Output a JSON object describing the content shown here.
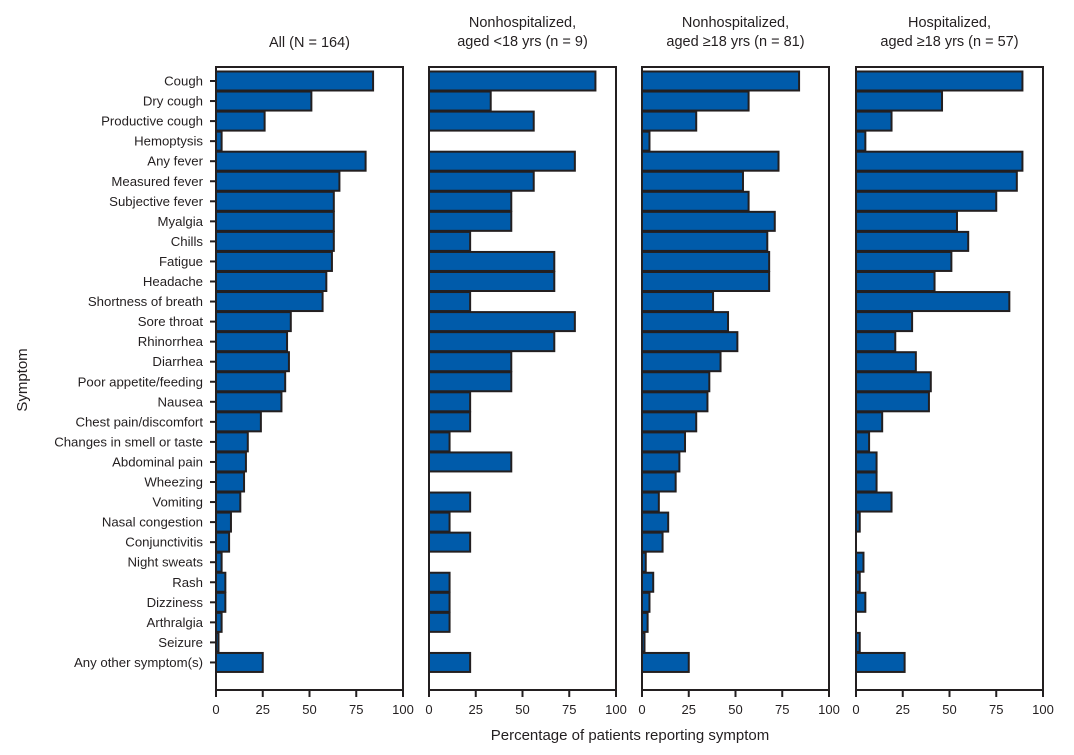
{
  "chart_data": {
    "type": "bar",
    "orientation": "horizontal",
    "xlabel": "Percentage of patients reporting symptom",
    "ylabel": "Symptom",
    "xlim": [
      0,
      100
    ],
    "xticks": [
      0,
      25,
      50,
      75,
      100
    ],
    "grid": false,
    "bar_color": "#005baa",
    "categories": [
      "Cough",
      "Dry cough",
      "Productive cough",
      "Hemoptysis",
      "Any fever",
      "Measured fever",
      "Subjective fever",
      "Myalgia",
      "Chills",
      "Fatigue",
      "Headache",
      "Shortness of breath",
      "Sore throat",
      "Rhinorrhea",
      "Diarrhea",
      "Poor appetite/feeding",
      "Nausea",
      "Chest pain/discomfort",
      "Changes in smell or taste",
      "Abdominal pain",
      "Wheezing",
      "Vomiting",
      "Nasal congestion",
      "Conjunctivitis",
      "Night sweats",
      "Rash",
      "Dizziness",
      "Arthralgia",
      "Seizure",
      "Any other symptom(s)"
    ],
    "panels": [
      {
        "title_lines": [
          "All (N = 164)"
        ],
        "values": [
          84,
          51,
          26,
          3,
          80,
          66,
          63,
          63,
          63,
          62,
          59,
          57,
          40,
          38,
          39,
          37,
          35,
          24,
          17,
          16,
          15,
          13,
          8,
          7,
          3,
          5,
          5,
          3,
          1,
          25
        ]
      },
      {
        "title_lines": [
          "Nonhospitalized,",
          "aged <18 yrs (n = 9)"
        ],
        "values": [
          89,
          33,
          56,
          0,
          78,
          56,
          44,
          44,
          22,
          67,
          67,
          22,
          78,
          67,
          44,
          44,
          22,
          22,
          11,
          44,
          0,
          22,
          11,
          22,
          0,
          11,
          11,
          11,
          0,
          22
        ]
      },
      {
        "title_lines": [
          "Nonhospitalized,",
          "aged ≥18 yrs (n = 81)"
        ],
        "values": [
          84,
          57,
          29,
          4,
          73,
          54,
          57,
          71,
          67,
          68,
          68,
          38,
          46,
          51,
          42,
          36,
          35,
          29,
          23,
          20,
          18,
          9,
          14,
          11,
          2,
          6,
          4,
          3,
          1,
          25
        ]
      },
      {
        "title_lines": [
          "Hospitalized,",
          "aged ≥18 yrs (n = 57)"
        ],
        "values": [
          89,
          46,
          19,
          5,
          89,
          86,
          75,
          54,
          60,
          51,
          42,
          82,
          30,
          21,
          32,
          40,
          39,
          14,
          7,
          11,
          11,
          19,
          2,
          0,
          4,
          2,
          5,
          0,
          2,
          26
        ]
      }
    ]
  }
}
